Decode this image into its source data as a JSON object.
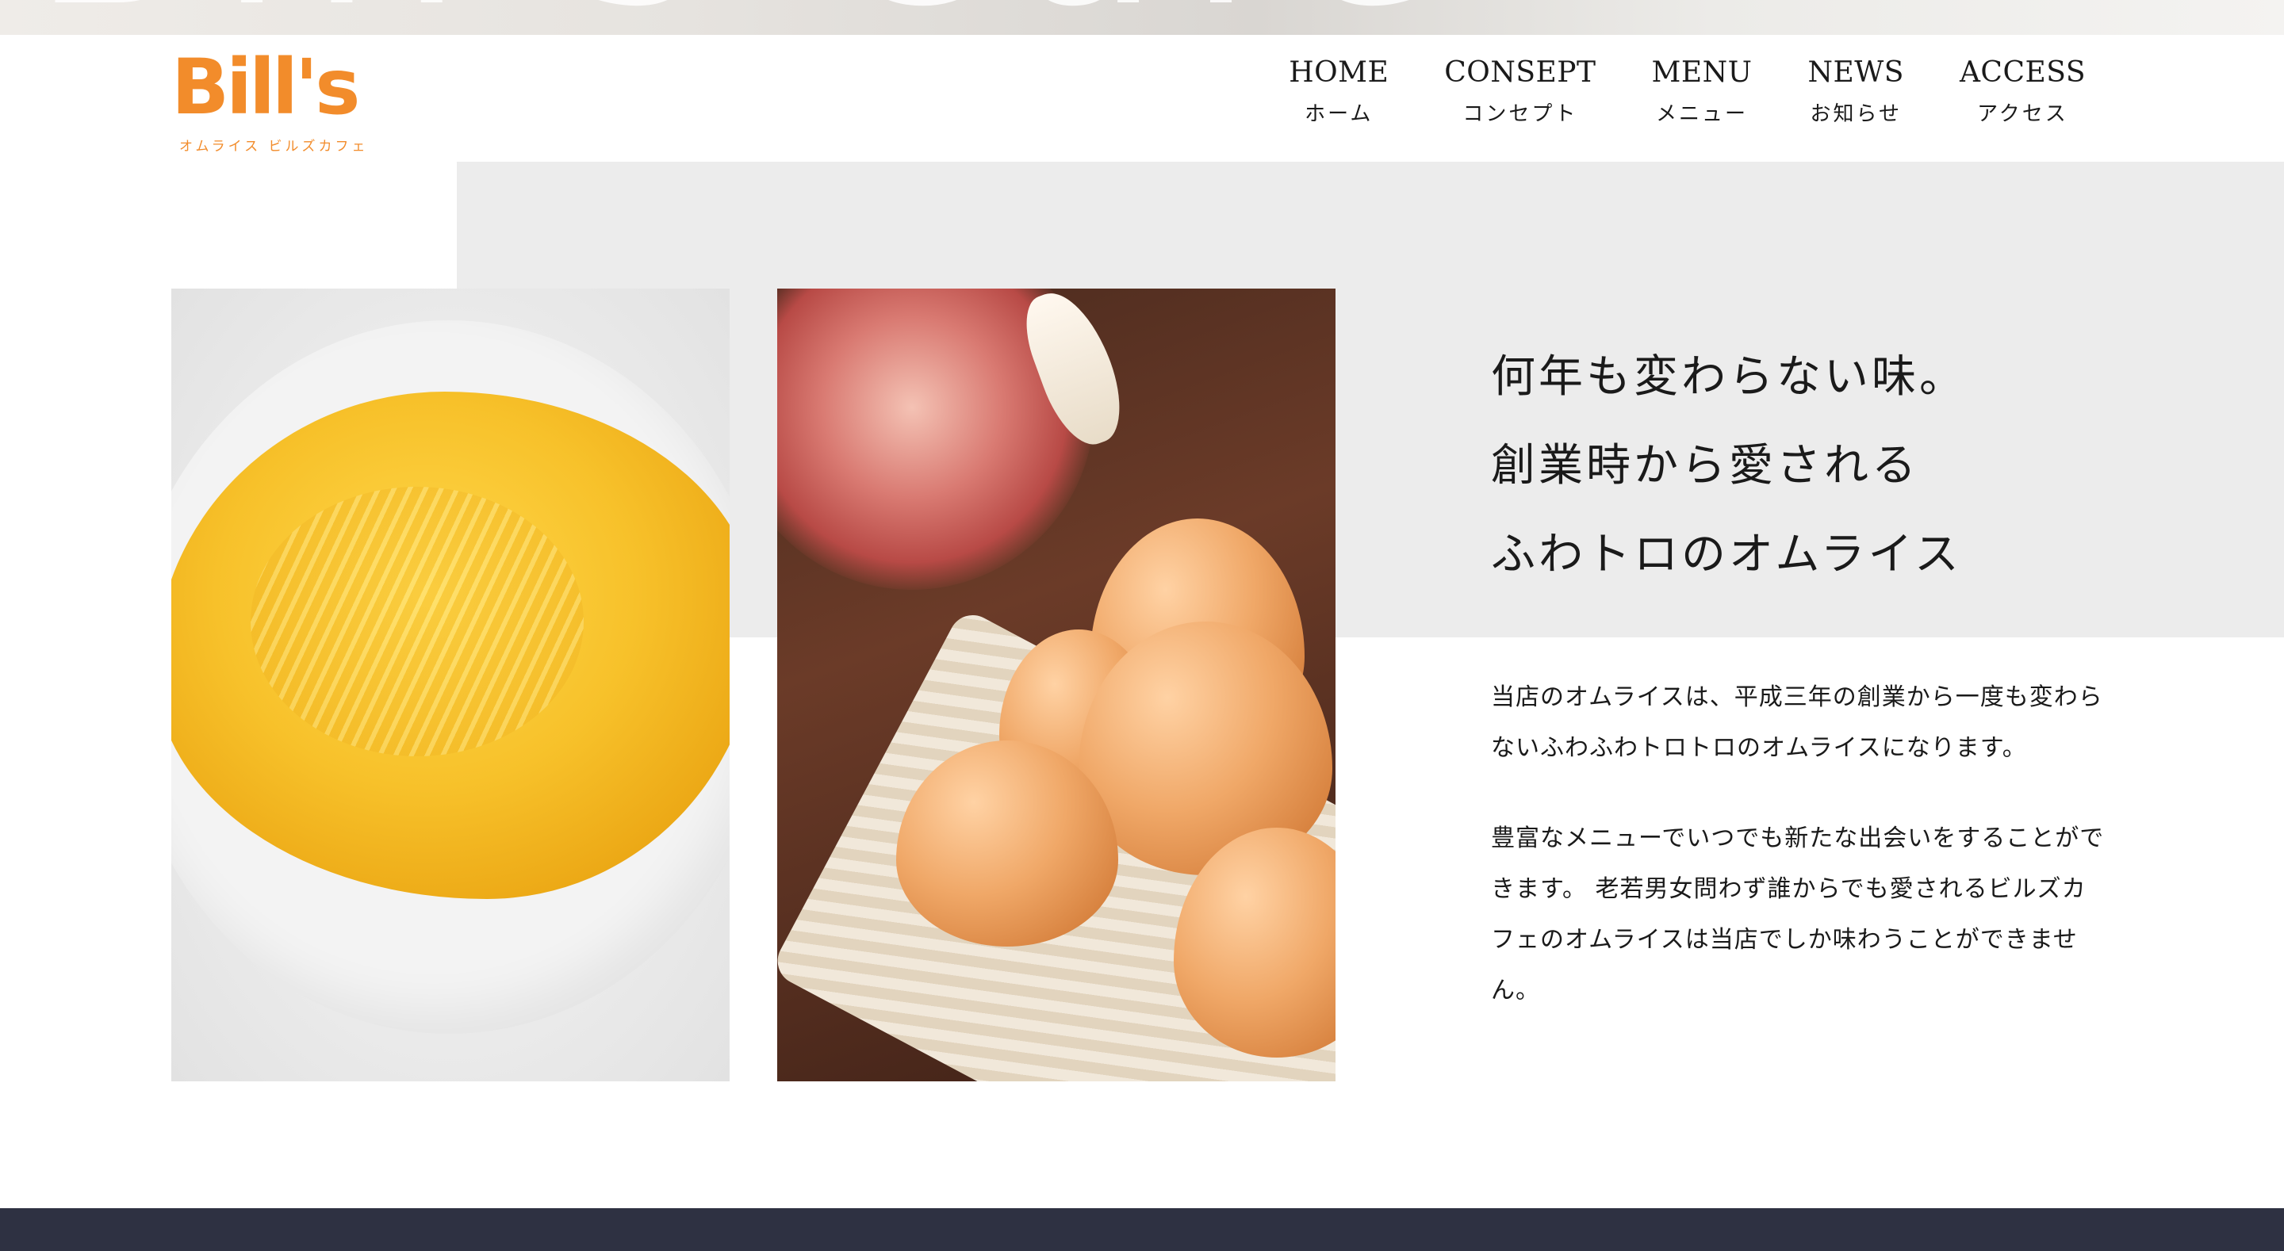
{
  "hero": {
    "ghost_text": "Bill's Cafe"
  },
  "header": {
    "logo": {
      "mark": "Bill's",
      "subtitle": "オムライス ビルズカフェ"
    },
    "nav": [
      {
        "en": "HOME",
        "jp": "ホーム"
      },
      {
        "en": "CONSEPT",
        "jp": "コンセプト"
      },
      {
        "en": "MENU",
        "jp": "メニュー"
      },
      {
        "en": "NEWS",
        "jp": "お知らせ"
      },
      {
        "en": "ACCESS",
        "jp": "アクセス"
      }
    ]
  },
  "concept": {
    "headline": [
      "何年も変わらない味。",
      "創業時から愛される",
      "ふわトロのオムライス"
    ],
    "paragraphs": [
      "当店のオムライスは、平成三年の創業から一度も変わらないふわふわトロトロのオムライスになります。",
      "豊富なメニューでいつでも新たな出会いをすることができます。 老若男女問わず誰からでも愛されるビルズカフェのオムライスは当店でしか味わうことができません。"
    ],
    "images": [
      {
        "icon": "omelet-photo"
      },
      {
        "icon": "eggs-basket-photo"
      }
    ]
  },
  "colors": {
    "brand_orange": "#f28c2b",
    "panel_grey": "#ececec",
    "footer_navy": "#2e3142"
  }
}
